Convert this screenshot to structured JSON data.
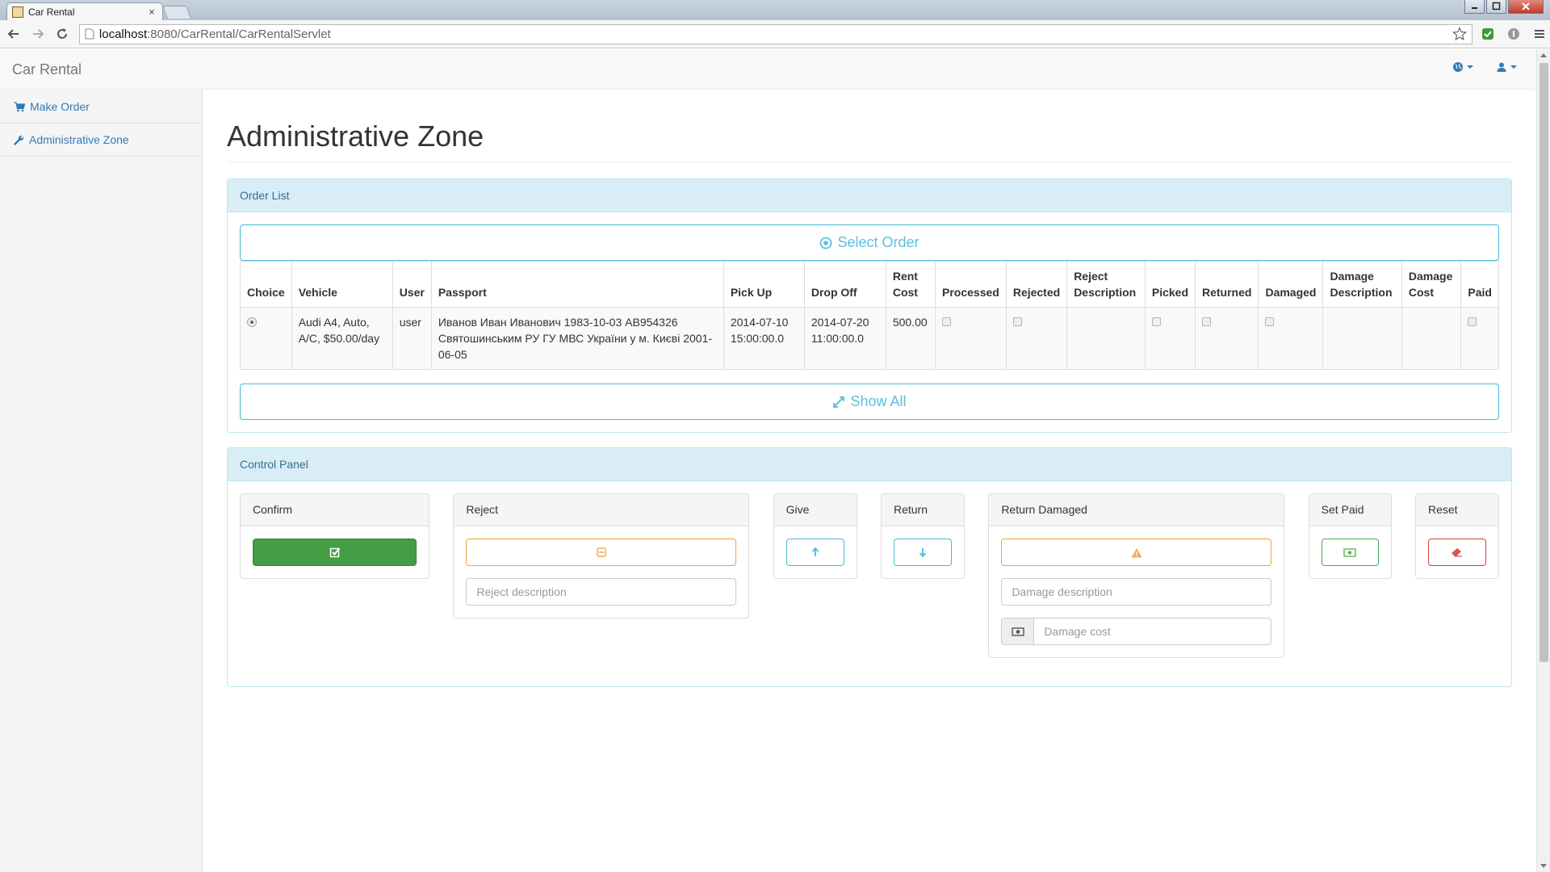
{
  "browser": {
    "tab_title": "Car Rental",
    "tab_close": "×",
    "url_host": "localhost",
    "url_path": ":8080/CarRental/CarRentalServlet"
  },
  "navbar": {
    "brand": "Car Rental",
    "language_icon": "globe-icon",
    "user_icon": "user-icon"
  },
  "sidebar": {
    "items": [
      {
        "label": "Make Order",
        "icon": "shopping-cart-icon"
      },
      {
        "label": "Administrative Zone",
        "icon": "wrench-icon"
      }
    ]
  },
  "main": {
    "title": "Administrative Zone",
    "order_list": {
      "heading": "Order List",
      "select_order_label": "Select Order",
      "show_all_label": "Show All",
      "columns": [
        "Choice",
        "Vehicle",
        "User",
        "Passport",
        "Pick Up",
        "Drop Off",
        "Rent Cost",
        "Processed",
        "Rejected",
        "Reject Description",
        "Picked",
        "Returned",
        "Damaged",
        "Damage Description",
        "Damage Cost",
        "Paid"
      ],
      "rows": [
        {
          "choice_selected": true,
          "vehicle": "Audi A4, Auto, A/C, $50.00/day",
          "user": "user",
          "passport": "Иванов Иван Иванович 1983-10-03 AB954326 Святошинським РУ ГУ МВС України у м. Києві 2001-06-05",
          "pick_up": "2014-07-10 15:00:00.0",
          "drop_off": "2014-07-20 11:00:00.0",
          "rent_cost": "500.00",
          "processed": false,
          "rejected": false,
          "reject_description": "",
          "picked": false,
          "returned": false,
          "damaged": false,
          "damage_description": "",
          "damage_cost": "",
          "paid": false
        }
      ]
    },
    "control_panel": {
      "heading": "Control Panel",
      "confirm": {
        "heading": "Confirm",
        "icon": "check-square-icon"
      },
      "reject": {
        "heading": "Reject",
        "icon": "minus-square-icon",
        "placeholder": "Reject description"
      },
      "give": {
        "heading": "Give",
        "icon": "arrow-up-icon"
      },
      "return": {
        "heading": "Return",
        "icon": "arrow-down-icon"
      },
      "return_damaged": {
        "heading": "Return Damaged",
        "icon": "warning-icon",
        "description_placeholder": "Damage description",
        "cost_placeholder": "Damage cost",
        "cost_icon": "money-icon"
      },
      "set_paid": {
        "heading": "Set Paid",
        "icon": "money-icon"
      },
      "reset": {
        "heading": "Reset",
        "icon": "eraser-icon"
      }
    }
  },
  "colors": {
    "info": "#5bc0de",
    "success": "#449d44",
    "warning": "#f0ad4e",
    "danger": "#d9534f",
    "panel_info_bg": "#d9edf7",
    "link": "#337ab7"
  }
}
